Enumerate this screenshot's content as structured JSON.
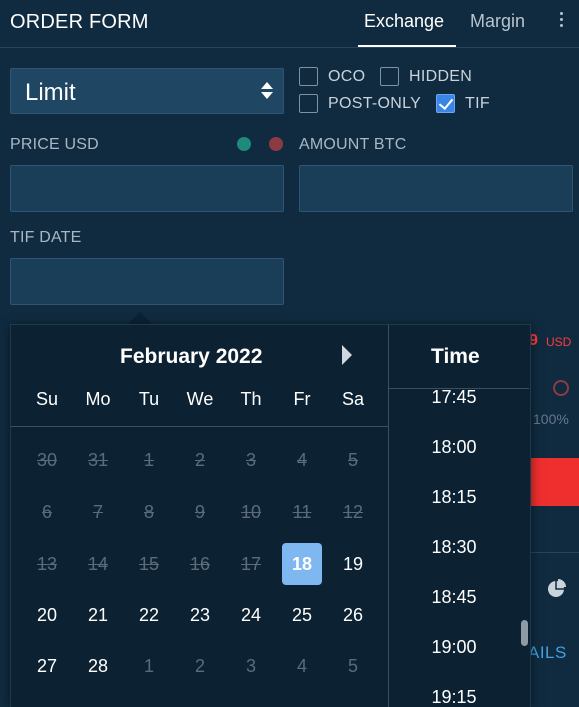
{
  "header": {
    "title": "ORDER FORM",
    "tabs": [
      {
        "label": "Exchange",
        "active": true
      },
      {
        "label": "Margin",
        "active": false
      }
    ],
    "menu_icon": "kebab-icon"
  },
  "order_type": {
    "value": "Limit"
  },
  "options": [
    {
      "label": "OCO",
      "checked": false
    },
    {
      "label": "HIDDEN",
      "checked": false
    },
    {
      "label": "POST-ONLY",
      "checked": false
    },
    {
      "label": "TIF",
      "checked": true
    }
  ],
  "fields": {
    "price_label": "PRICE USD",
    "amount_label": "AMOUNT BTC",
    "tif_label": "TIF DATE"
  },
  "background": {
    "price_digit": "9",
    "price_currency": "USD",
    "percent": "100%",
    "details_fragment": "AILS"
  },
  "datepicker": {
    "month_label": "February 2022",
    "weekdays": [
      "Su",
      "Mo",
      "Tu",
      "We",
      "Th",
      "Fr",
      "Sa"
    ],
    "weeks": [
      [
        {
          "d": "30",
          "s": "dis"
        },
        {
          "d": "31",
          "s": "dis"
        },
        {
          "d": "1",
          "s": "dis"
        },
        {
          "d": "2",
          "s": "dis"
        },
        {
          "d": "3",
          "s": "dis"
        },
        {
          "d": "4",
          "s": "dis"
        },
        {
          "d": "5",
          "s": "dis"
        }
      ],
      [
        {
          "d": "6",
          "s": "dis"
        },
        {
          "d": "7",
          "s": "dis"
        },
        {
          "d": "8",
          "s": "dis"
        },
        {
          "d": "9",
          "s": "dis"
        },
        {
          "d": "10",
          "s": "dis"
        },
        {
          "d": "11",
          "s": "dis"
        },
        {
          "d": "12",
          "s": "dis"
        }
      ],
      [
        {
          "d": "13",
          "s": "dis"
        },
        {
          "d": "14",
          "s": "dis"
        },
        {
          "d": "15",
          "s": "dis"
        },
        {
          "d": "16",
          "s": "dis"
        },
        {
          "d": "17",
          "s": "dis"
        },
        {
          "d": "18",
          "s": "sel"
        },
        {
          "d": "19",
          "s": "cur"
        }
      ],
      [
        {
          "d": "20",
          "s": "cur"
        },
        {
          "d": "21",
          "s": "cur"
        },
        {
          "d": "22",
          "s": "cur"
        },
        {
          "d": "23",
          "s": "cur"
        },
        {
          "d": "24",
          "s": "cur"
        },
        {
          "d": "25",
          "s": "cur"
        },
        {
          "d": "26",
          "s": "cur"
        }
      ],
      [
        {
          "d": "27",
          "s": "cur"
        },
        {
          "d": "28",
          "s": "cur"
        },
        {
          "d": "1",
          "s": "next"
        },
        {
          "d": "2",
          "s": "next"
        },
        {
          "d": "3",
          "s": "next"
        },
        {
          "d": "4",
          "s": "next"
        },
        {
          "d": "5",
          "s": "next"
        }
      ]
    ],
    "time_title": "Time",
    "times": [
      "17:45",
      "18:00",
      "18:15",
      "18:30",
      "18:45",
      "19:00",
      "19:15"
    ]
  },
  "colors": {
    "background": "#102b3f",
    "input": "#1a3e58",
    "picker": "#0c2233",
    "selected_day": "#7fb8f0",
    "checkbox_checked": "#3a86e6",
    "sell_red": "#ef2e2e",
    "link_blue": "#3fa2e0"
  }
}
